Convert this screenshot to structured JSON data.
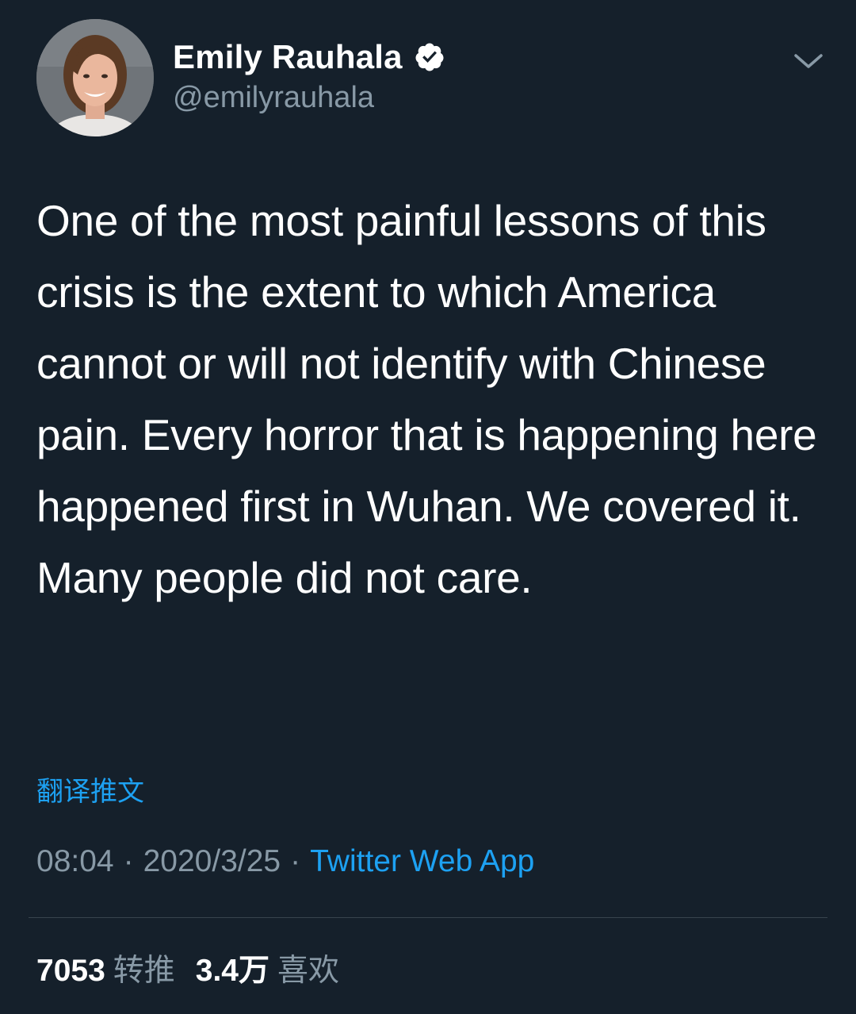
{
  "tweet": {
    "author": {
      "display_name": "Emily Rauhala",
      "handle": "@emilyrauhala",
      "verified": true
    },
    "text": "One of the most painful lessons of this crisis is the extent to which America cannot or will not identify with Chinese pain. Every horror that is happening here happened first in Wuhan. We covered it. Many people did not care.",
    "translate_label": "翻译推文",
    "time": "08:04",
    "date": "2020/3/25",
    "separator": "·",
    "source": "Twitter Web App",
    "retweets": {
      "count": "7053",
      "label": "转推"
    },
    "likes": {
      "count": "3.4万",
      "label": "喜欢"
    }
  },
  "icons": {
    "verified": "verified-badge-icon",
    "more": "chevron-down-icon"
  },
  "colors": {
    "background": "#15202b",
    "text": "#ffffff",
    "secondary_text": "#8899a6",
    "accent": "#1da1f2",
    "divider": "#38444d"
  }
}
